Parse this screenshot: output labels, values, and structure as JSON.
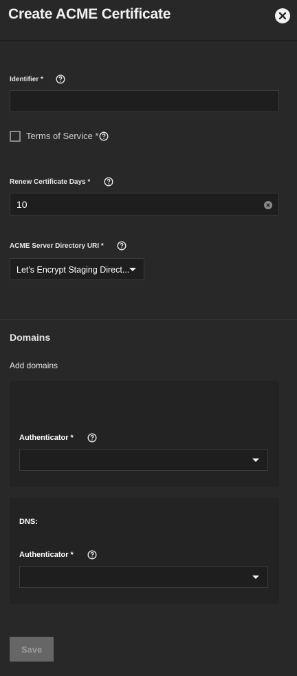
{
  "header": {
    "title": "Create ACME Certificate"
  },
  "form": {
    "identifier": {
      "label": "Identifier *",
      "value": ""
    },
    "tos": {
      "label": "Terms of Service *",
      "checked": false
    },
    "renew_days": {
      "label": "Renew Certificate Days *",
      "value": "10"
    },
    "directory_uri": {
      "label": "ACME Server Directory URI *",
      "value": "Let's Encrypt Staging Direct..."
    }
  },
  "domains": {
    "title": "Domains",
    "subtitle": "Add domains",
    "cards": [
      {
        "heading": "",
        "authenticator_label": "Authenticator *",
        "authenticator_value": ""
      },
      {
        "heading": "DNS:",
        "authenticator_label": "Authenticator *",
        "authenticator_value": ""
      }
    ]
  },
  "actions": {
    "save_label": "Save"
  },
  "icons": {
    "close": "close-icon",
    "help": "help-circle-icon",
    "clear": "clear-circle-icon",
    "dropdown": "caret-down-icon"
  },
  "colors": {
    "background": "#282828",
    "input_bg": "#1e1e1e",
    "card_bg": "#232323",
    "save_disabled": "#666666"
  }
}
